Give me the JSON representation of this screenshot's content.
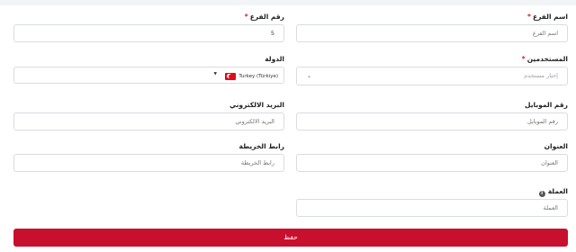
{
  "form": {
    "branch_name": {
      "label": "اسم الفرع",
      "required": "*",
      "placeholder": "اسم الفرع",
      "value": ""
    },
    "branch_number": {
      "label": "رقم الفرع",
      "required": "*",
      "value": "5"
    },
    "users": {
      "label": "المستخدمين",
      "required": "*",
      "placeholder": "إختار مستخدم",
      "caret_icon": "chevron-down-icon"
    },
    "country": {
      "label": "الدولة",
      "selected": "Turkey (Türkiye)",
      "flag_icon": "turkey-flag-icon",
      "caret_icon": "caret-down-icon"
    },
    "mobile": {
      "label": "رقم الموبايل",
      "placeholder": "رقم الموبايل"
    },
    "email": {
      "label": "البريد الالكتروني",
      "placeholder": "البريد الالكتروني"
    },
    "address": {
      "label": "العنوان",
      "placeholder": "العنوان"
    },
    "map_link": {
      "label": "رابط الخريطة",
      "placeholder": "رابط الخريطة"
    },
    "currency": {
      "label": "العملة",
      "info_icon": "info-icon",
      "info_glyph": "i",
      "placeholder": "العملة"
    }
  },
  "actions": {
    "save_label": "حفظ"
  },
  "colors": {
    "accent": "#c8102e",
    "required": "#d71f33",
    "border": "#d9dce1"
  }
}
